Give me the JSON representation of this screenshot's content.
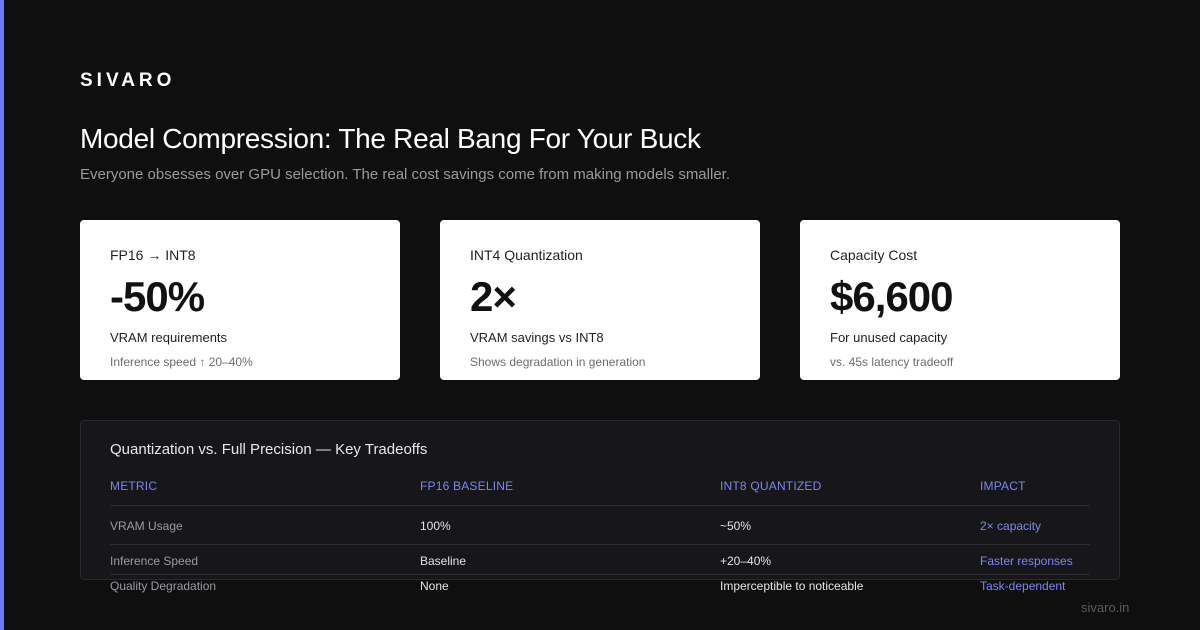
{
  "brand": {
    "logo": "SIVARO",
    "accent_color": "#6b7cf0",
    "footer_url": "sivaro.in"
  },
  "header": {
    "title": "Model Compression: The Real Bang For Your Buck",
    "subtitle": "Everyone obsesses over GPU selection. The real cost savings come from making models smaller."
  },
  "cards": [
    {
      "label": "FP16 → INT8",
      "value": "-50%",
      "desc": "VRAM requirements",
      "note": "Inference speed ↑ 20–40%"
    },
    {
      "label": "INT4 Quantization",
      "value": "2×",
      "desc": "VRAM savings vs INT8",
      "note": "Shows degradation in generation"
    },
    {
      "label": "Capacity Cost",
      "value": "$6,600",
      "desc": "For unused capacity",
      "note": "vs. 45s latency tradeoff"
    }
  ],
  "table": {
    "title": "Quantization vs. Full Precision — Key Tradeoffs",
    "columns": [
      "METRIC",
      "FP16 BASELINE",
      "INT8 QUANTIZED",
      "IMPACT"
    ],
    "rows": [
      [
        "VRAM Usage",
        "100%",
        "~50%",
        "2× capacity"
      ],
      [
        "Inference Speed",
        "Baseline",
        "+20–40%",
        "Faster responses"
      ],
      [
        "Quality Degradation",
        "None",
        "Imperceptible to noticeable",
        "Task-dependent"
      ]
    ]
  }
}
